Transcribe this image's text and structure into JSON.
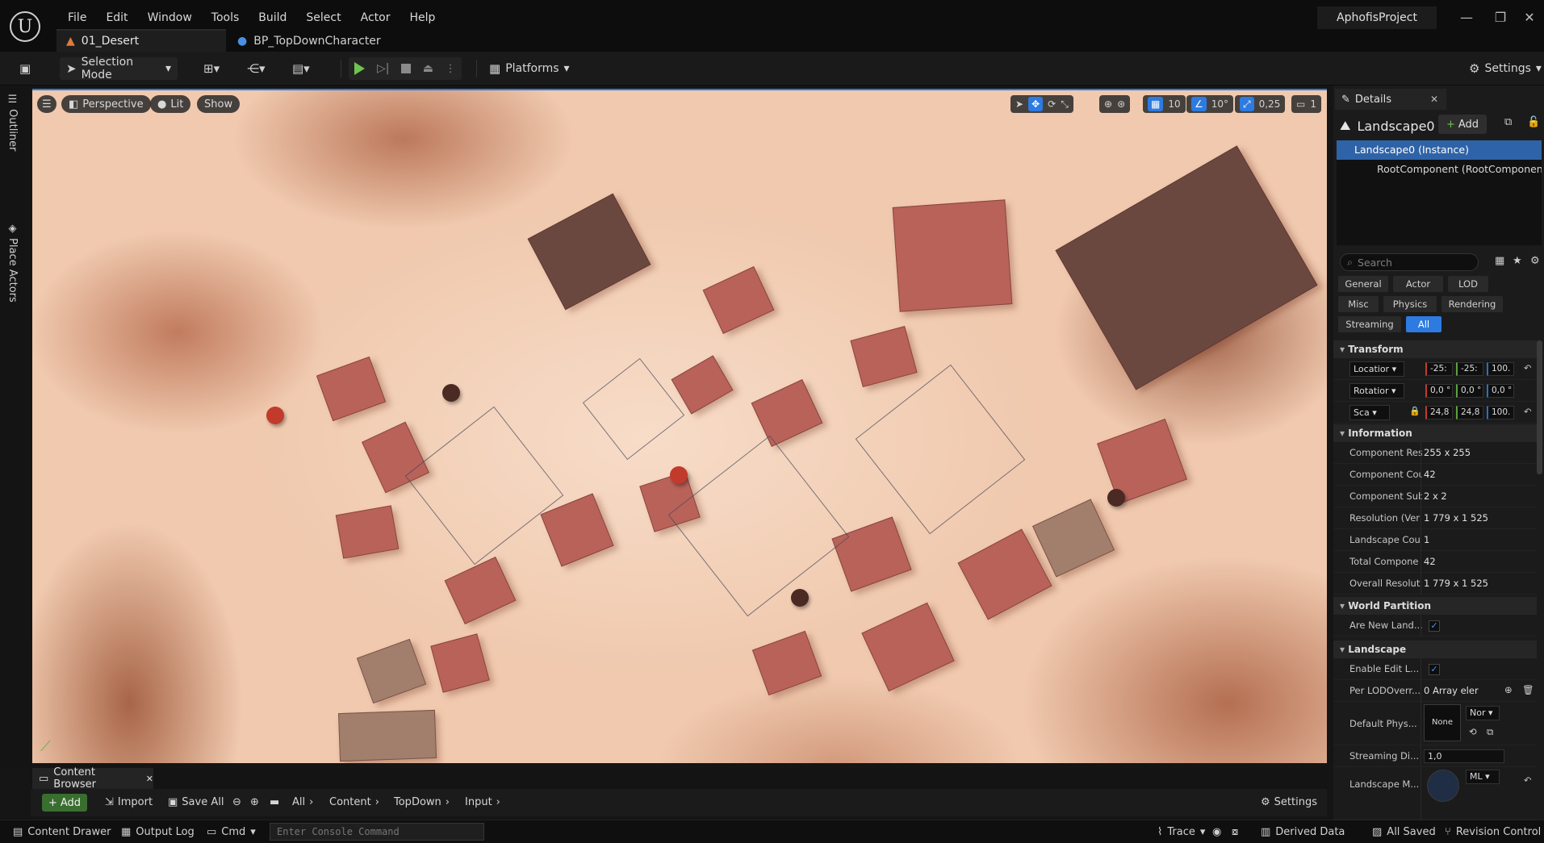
{
  "menu": {
    "items": [
      "File",
      "Edit",
      "Window",
      "Tools",
      "Build",
      "Select",
      "Actor",
      "Help"
    ]
  },
  "tabs": {
    "level": "01_Desert",
    "blueprint": "BP_TopDownCharacter"
  },
  "project": "AphofisProject",
  "toolbar": {
    "selection_mode": "Selection Mode",
    "platforms": "Platforms",
    "settings": "Settings"
  },
  "vertical_tabs": {
    "outliner": "Outliner",
    "place_actors": "Place Actors"
  },
  "viewport": {
    "perspective": "Perspective",
    "lit": "Lit",
    "show": "Show",
    "grid_snap": "10",
    "rotation_snap": "10°",
    "scale_snap": "0,25",
    "camera_speed": "1"
  },
  "details": {
    "tab": "Details",
    "actor": "Landscape0",
    "add": "Add",
    "components": [
      "Landscape0 (Instance)",
      "RootComponent (RootComponent0)"
    ],
    "search_placeholder": "Search",
    "filters": [
      "General",
      "Actor",
      "LOD",
      "Misc",
      "Physics",
      "Rendering",
      "Streaming",
      "All"
    ],
    "sections": {
      "transform": "Transform",
      "information": "Information",
      "world_partition": "World Partition",
      "landscape": "Landscape"
    },
    "transform": {
      "location_label": "Locatior",
      "location": [
        "-25:",
        "-25:",
        "100."
      ],
      "rotation_label": "Rotatior",
      "rotation": [
        "0,0 °",
        "0,0 °",
        "0,0 °"
      ],
      "scale_label": "Sca",
      "scale": [
        "24,8",
        "24,8",
        "100."
      ]
    },
    "information": [
      {
        "label": "Component Res",
        "value": "255 x 255"
      },
      {
        "label": "Component Cou",
        "value": "42"
      },
      {
        "label": "Component Sub",
        "value": "2 x 2"
      },
      {
        "label": "Resolution (Ver",
        "value": "1 779 x 1 525"
      },
      {
        "label": "Landscape Cou",
        "value": "1"
      },
      {
        "label": "Total Compone",
        "value": "42"
      },
      {
        "label": "Overall Resolut",
        "value": "1 779 x 1 525"
      }
    ],
    "world_partition": {
      "are_new_label": "Are New Land..."
    },
    "landscape": {
      "enable_edit_label": "Enable Edit L...",
      "per_lod_label": "Per LODOverr...",
      "per_lod_value": "0 Array eler",
      "default_phys_label": "Default Phys...",
      "default_phys_thumb": "None",
      "default_phys_dd": "Nor",
      "streaming_label": "Streaming Di...",
      "streaming_value": "1,0",
      "landscape_m_label": "Landscape M...",
      "landscape_m_dd": "ML"
    }
  },
  "content_browser": {
    "tab": "Content Browser",
    "add": "Add",
    "import": "Import",
    "save_all": "Save All",
    "breadcrumb": [
      "All",
      "Content",
      "TopDown",
      "Input"
    ],
    "settings": "Settings"
  },
  "statusbar": {
    "content_drawer": "Content Drawer",
    "output_log": "Output Log",
    "cmd": "Cmd",
    "console_placeholder": "Enter Console Command",
    "trace": "Trace",
    "derived_data": "Derived Data",
    "all_saved": "All Saved",
    "revision_control": "Revision Control"
  }
}
